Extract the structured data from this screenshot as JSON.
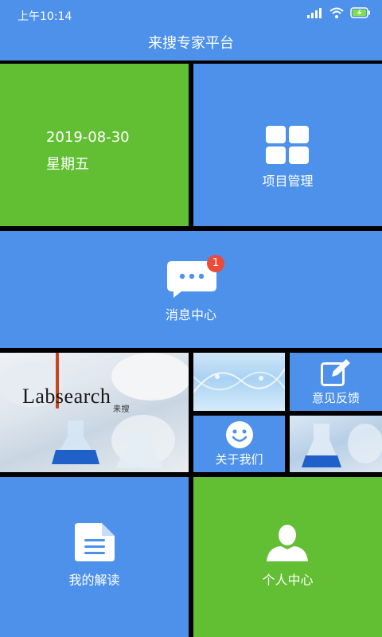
{
  "status_bar": {
    "time": "上午10:14"
  },
  "app": {
    "title": "来搜专家平台"
  },
  "date_tile": {
    "date": "2019-08-30",
    "weekday": "星期五"
  },
  "project_tile": {
    "label": "项目管理",
    "icon": "grid-icon"
  },
  "messages_tile": {
    "label": "消息中心",
    "badge": "1",
    "icon": "chat-bubble-icon"
  },
  "banner": {
    "logo_text": "Labsearch",
    "logo_sub": "来搜"
  },
  "feedback_tile": {
    "label": "意见反馈",
    "icon": "edit-icon"
  },
  "about_tile": {
    "label": "关于我们",
    "icon": "smiley-icon"
  },
  "reading_tile": {
    "label": "我的解读",
    "icon": "document-icon"
  },
  "profile_tile": {
    "label": "个人中心",
    "icon": "person-icon"
  },
  "colors": {
    "blue": "#4d91ea",
    "green": "#62bf34",
    "badge": "#ea4c3a"
  }
}
